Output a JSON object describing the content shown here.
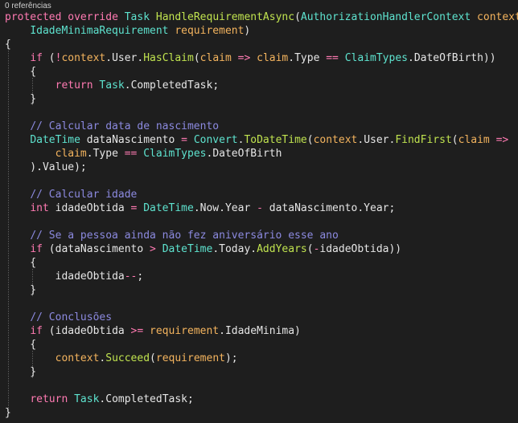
{
  "codelens": {
    "references": "0 referências"
  },
  "colors": {
    "background": "#1e1e1e",
    "keyword": "#ff7ab2",
    "type": "#5ee3cf",
    "method": "#c0e34f",
    "parameter": "#f4b45e",
    "comment": "#8c8ae0",
    "text": "#e6e6e6"
  },
  "lines": [
    [
      [
        "kw",
        "protected"
      ],
      [
        "p",
        " "
      ],
      [
        "kw",
        "override"
      ],
      [
        "p",
        " "
      ],
      [
        "ty",
        "Task"
      ],
      [
        "p",
        " "
      ],
      [
        "fn",
        "HandleRequirementAsync"
      ],
      [
        "p",
        "("
      ],
      [
        "ty",
        "AuthorizationHandlerContext"
      ],
      [
        "p",
        " "
      ],
      [
        "param",
        "context"
      ],
      [
        "p",
        ","
      ]
    ],
    [
      [
        "p",
        "    "
      ],
      [
        "ty",
        "IdadeMinimaRequirement"
      ],
      [
        "p",
        " "
      ],
      [
        "param",
        "requirement"
      ],
      [
        "p",
        ")"
      ]
    ],
    [
      [
        "p",
        "{"
      ]
    ],
    [
      [
        "p",
        "    "
      ],
      [
        "kw",
        "if"
      ],
      [
        "p",
        " ("
      ],
      [
        "op",
        "!"
      ],
      [
        "param",
        "context"
      ],
      [
        "p",
        "."
      ],
      [
        "prop",
        "User"
      ],
      [
        "p",
        "."
      ],
      [
        "fn",
        "HasClaim"
      ],
      [
        "p",
        "("
      ],
      [
        "param",
        "claim"
      ],
      [
        "p",
        " "
      ],
      [
        "op",
        "=>"
      ],
      [
        "p",
        " "
      ],
      [
        "param",
        "claim"
      ],
      [
        "p",
        "."
      ],
      [
        "prop",
        "Type"
      ],
      [
        "p",
        " "
      ],
      [
        "op",
        "=="
      ],
      [
        "p",
        " "
      ],
      [
        "ty",
        "ClaimTypes"
      ],
      [
        "p",
        "."
      ],
      [
        "prop",
        "DateOfBirth"
      ],
      [
        "p",
        "))"
      ]
    ],
    [
      [
        "p",
        "    {"
      ]
    ],
    [
      [
        "p",
        "        "
      ],
      [
        "kw",
        "return"
      ],
      [
        "p",
        " "
      ],
      [
        "ty",
        "Task"
      ],
      [
        "p",
        "."
      ],
      [
        "prop",
        "CompletedTask"
      ],
      [
        "p",
        ";"
      ]
    ],
    [
      [
        "p",
        "    }"
      ]
    ],
    [
      [
        "p",
        ""
      ]
    ],
    [
      [
        "p",
        "    "
      ],
      [
        "cm",
        "// Calcular data de nascimento"
      ]
    ],
    [
      [
        "p",
        "    "
      ],
      [
        "ty",
        "DateTime"
      ],
      [
        "p",
        " "
      ],
      [
        "var",
        "dataNascimento"
      ],
      [
        "p",
        " "
      ],
      [
        "op",
        "="
      ],
      [
        "p",
        " "
      ],
      [
        "ty",
        "Convert"
      ],
      [
        "p",
        "."
      ],
      [
        "fn",
        "ToDateTime"
      ],
      [
        "p",
        "("
      ],
      [
        "param",
        "context"
      ],
      [
        "p",
        "."
      ],
      [
        "prop",
        "User"
      ],
      [
        "p",
        "."
      ],
      [
        "fn",
        "FindFirst"
      ],
      [
        "p",
        "("
      ],
      [
        "param",
        "claim"
      ],
      [
        "p",
        " "
      ],
      [
        "op",
        "=>"
      ]
    ],
    [
      [
        "p",
        "        "
      ],
      [
        "param",
        "claim"
      ],
      [
        "p",
        "."
      ],
      [
        "prop",
        "Type"
      ],
      [
        "p",
        " "
      ],
      [
        "op",
        "=="
      ],
      [
        "p",
        " "
      ],
      [
        "ty",
        "ClaimTypes"
      ],
      [
        "p",
        "."
      ],
      [
        "prop",
        "DateOfBirth"
      ]
    ],
    [
      [
        "p",
        "    )."
      ],
      [
        "prop",
        "Value"
      ],
      [
        "p",
        ");"
      ]
    ],
    [
      [
        "p",
        ""
      ]
    ],
    [
      [
        "p",
        "    "
      ],
      [
        "cm",
        "// Calcular idade"
      ]
    ],
    [
      [
        "p",
        "    "
      ],
      [
        "kw",
        "int"
      ],
      [
        "p",
        " "
      ],
      [
        "var",
        "idadeObtida"
      ],
      [
        "p",
        " "
      ],
      [
        "op",
        "="
      ],
      [
        "p",
        " "
      ],
      [
        "ty",
        "DateTime"
      ],
      [
        "p",
        "."
      ],
      [
        "prop",
        "Now"
      ],
      [
        "p",
        "."
      ],
      [
        "prop",
        "Year"
      ],
      [
        "p",
        " "
      ],
      [
        "op",
        "-"
      ],
      [
        "p",
        " "
      ],
      [
        "var",
        "dataNascimento"
      ],
      [
        "p",
        "."
      ],
      [
        "prop",
        "Year"
      ],
      [
        "p",
        ";"
      ]
    ],
    [
      [
        "p",
        ""
      ]
    ],
    [
      [
        "p",
        "    "
      ],
      [
        "cm",
        "// Se a pessoa ainda não fez aniversário esse ano"
      ]
    ],
    [
      [
        "p",
        "    "
      ],
      [
        "kw",
        "if"
      ],
      [
        "p",
        " ("
      ],
      [
        "var",
        "dataNascimento"
      ],
      [
        "p",
        " "
      ],
      [
        "op",
        ">"
      ],
      [
        "p",
        " "
      ],
      [
        "ty",
        "DateTime"
      ],
      [
        "p",
        "."
      ],
      [
        "prop",
        "Today"
      ],
      [
        "p",
        "."
      ],
      [
        "fn",
        "AddYears"
      ],
      [
        "p",
        "("
      ],
      [
        "op",
        "-"
      ],
      [
        "var",
        "idadeObtida"
      ],
      [
        "p",
        "))"
      ]
    ],
    [
      [
        "p",
        "    {"
      ]
    ],
    [
      [
        "p",
        "        "
      ],
      [
        "var",
        "idadeObtida"
      ],
      [
        "op",
        "--"
      ],
      [
        "p",
        ";"
      ]
    ],
    [
      [
        "p",
        "    }"
      ]
    ],
    [
      [
        "p",
        ""
      ]
    ],
    [
      [
        "p",
        "    "
      ],
      [
        "cm",
        "// Conclusões"
      ]
    ],
    [
      [
        "p",
        "    "
      ],
      [
        "kw",
        "if"
      ],
      [
        "p",
        " ("
      ],
      [
        "var",
        "idadeObtida"
      ],
      [
        "p",
        " "
      ],
      [
        "op",
        ">="
      ],
      [
        "p",
        " "
      ],
      [
        "param",
        "requirement"
      ],
      [
        "p",
        "."
      ],
      [
        "prop",
        "IdadeMinima"
      ],
      [
        "p",
        ")"
      ]
    ],
    [
      [
        "p",
        "    {"
      ]
    ],
    [
      [
        "p",
        "        "
      ],
      [
        "param",
        "context"
      ],
      [
        "p",
        "."
      ],
      [
        "fn",
        "Succeed"
      ],
      [
        "p",
        "("
      ],
      [
        "param",
        "requirement"
      ],
      [
        "p",
        ");"
      ]
    ],
    [
      [
        "p",
        "    }"
      ]
    ],
    [
      [
        "p",
        ""
      ]
    ],
    [
      [
        "p",
        "    "
      ],
      [
        "kw",
        "return"
      ],
      [
        "p",
        " "
      ],
      [
        "ty",
        "Task"
      ],
      [
        "p",
        "."
      ],
      [
        "prop",
        "CompletedTask"
      ],
      [
        "p",
        ";"
      ]
    ],
    [
      [
        "p",
        "}"
      ]
    ]
  ]
}
